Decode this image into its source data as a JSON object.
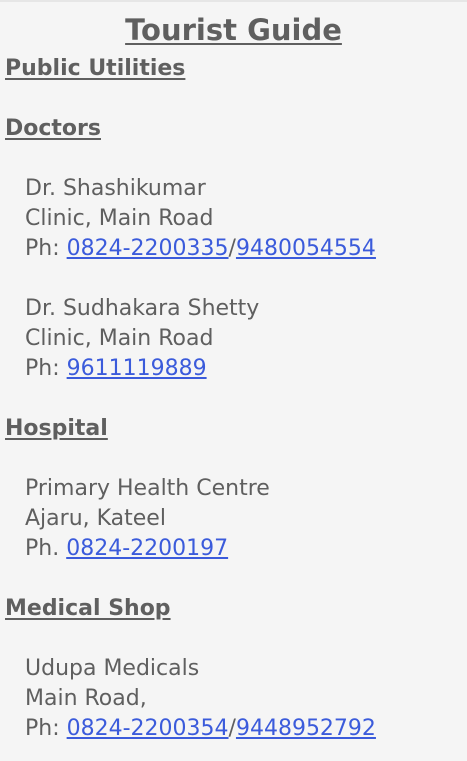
{
  "page": {
    "title": "Tourist Guide",
    "section_title": "Public Utilities"
  },
  "doctors": {
    "heading": "Doctors",
    "entries": [
      {
        "name": "Dr. Shashikumar",
        "address": "Clinic, Main Road",
        "phone_prefix": "Ph: ",
        "phones": [
          "0824-2200335",
          "9480054554"
        ]
      },
      {
        "name": "Dr. Sudhakara Shetty",
        "address": "Clinic, Main Road",
        "phone_prefix": "Ph: ",
        "phones": [
          "9611119889"
        ]
      }
    ]
  },
  "hospital": {
    "heading": "Hospital",
    "entries": [
      {
        "name": "Primary Health Centre",
        "address": "Ajaru, Kateel",
        "phone_prefix": "Ph. ",
        "phones": [
          "0824-2200197"
        ]
      }
    ]
  },
  "medical_shop": {
    "heading": "Medical Shop",
    "entries": [
      {
        "name": "Udupa Medicals",
        "address": "Main Road,",
        "phone_prefix": "Ph: ",
        "phones": [
          "0824-2200354",
          "9448952792"
        ]
      }
    ]
  },
  "separator": "/",
  "colors": {
    "text": "#5f5f5f",
    "link": "#3b5bdb",
    "background": "#f5f5f5"
  }
}
